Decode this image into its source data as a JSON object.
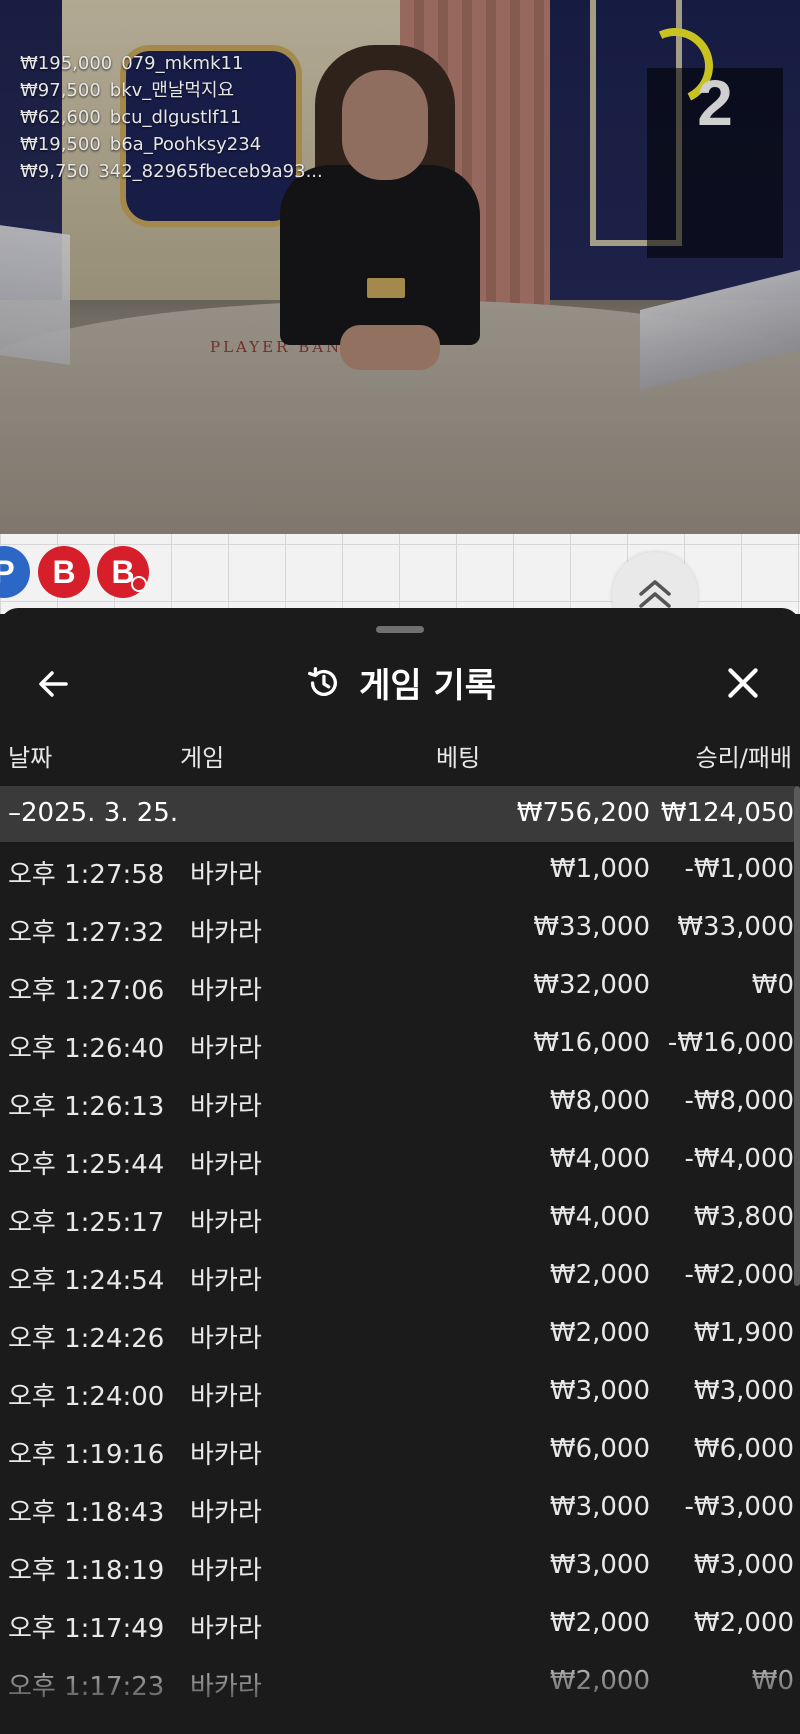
{
  "stream": {
    "top_winners": [
      {
        "amount": "₩195,000",
        "user": "079_mkmk11"
      },
      {
        "amount": "₩97,500",
        "user": "bkv_맨날먹지요"
      },
      {
        "amount": "₩62,600",
        "user": "bcu_dlgustlf11"
      },
      {
        "amount": "₩19,500",
        "user": "b6a_Poohksy234"
      },
      {
        "amount": "₩9,750",
        "user": "342_82965fbeceb9a93..."
      }
    ],
    "countdown": "2",
    "table_label": "PLAYER   BANKER"
  },
  "roadmap": {
    "beads": [
      {
        "letter": "P",
        "color": "#2c67c6"
      },
      {
        "letter": "B",
        "color": "#d61f2a"
      },
      {
        "letter": "B",
        "color": "#d61f2a"
      }
    ],
    "expand_icon": "double-chevron-up-icon"
  },
  "history": {
    "title": "게임 기록",
    "back_icon": "arrow-left-icon",
    "history_icon": "history-clock-icon",
    "close_icon": "close-icon",
    "columns": {
      "date": "날짜",
      "game": "게임",
      "bet": "베팅",
      "win_loss": "승리/패배"
    },
    "group": {
      "label": "–2025. 3. 25.",
      "bet_total": "₩756,200",
      "win_loss_total": "₩124,050"
    },
    "rows": [
      {
        "time": "오후 1:27:58",
        "game": "바카라",
        "bet": "₩1,000",
        "win_loss": "-₩1,000"
      },
      {
        "time": "오후 1:27:32",
        "game": "바카라",
        "bet": "₩33,000",
        "win_loss": "₩33,000"
      },
      {
        "time": "오후 1:27:06",
        "game": "바카라",
        "bet": "₩32,000",
        "win_loss": "₩0"
      },
      {
        "time": "오후 1:26:40",
        "game": "바카라",
        "bet": "₩16,000",
        "win_loss": "-₩16,000"
      },
      {
        "time": "오후 1:26:13",
        "game": "바카라",
        "bet": "₩8,000",
        "win_loss": "-₩8,000"
      },
      {
        "time": "오후 1:25:44",
        "game": "바카라",
        "bet": "₩4,000",
        "win_loss": "-₩4,000"
      },
      {
        "time": "오후 1:25:17",
        "game": "바카라",
        "bet": "₩4,000",
        "win_loss": "₩3,800"
      },
      {
        "time": "오후 1:24:54",
        "game": "바카라",
        "bet": "₩2,000",
        "win_loss": "-₩2,000"
      },
      {
        "time": "오후 1:24:26",
        "game": "바카라",
        "bet": "₩2,000",
        "win_loss": "₩1,900"
      },
      {
        "time": "오후 1:24:00",
        "game": "바카라",
        "bet": "₩3,000",
        "win_loss": "₩3,000"
      },
      {
        "time": "오후 1:19:16",
        "game": "바카라",
        "bet": "₩6,000",
        "win_loss": "₩6,000"
      },
      {
        "time": "오후 1:18:43",
        "game": "바카라",
        "bet": "₩3,000",
        "win_loss": "-₩3,000"
      },
      {
        "time": "오후 1:18:19",
        "game": "바카라",
        "bet": "₩3,000",
        "win_loss": "₩3,000"
      },
      {
        "time": "오후 1:17:49",
        "game": "바카라",
        "bet": "₩2,000",
        "win_loss": "₩2,000"
      },
      {
        "time": "오후 1:17:23",
        "game": "바카라",
        "bet": "₩2,000",
        "win_loss": "₩0"
      }
    ]
  }
}
